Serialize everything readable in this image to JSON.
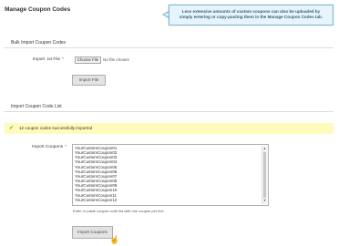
{
  "page": {
    "title": "Manage Coupon Codes"
  },
  "tooltip": {
    "line1": "Less extensive amounts of custom coupons can also be uploaded by",
    "line2": "simply entering or copy-pasting them in the Manage Coupon Codes tab."
  },
  "bulk_import": {
    "section_title": "Bulk Import Coupon Codes",
    "file_label": "Import .txt File",
    "required_mark": "*",
    "choose_file_label": "Choose File",
    "file_status": "No file chosen",
    "import_button": "Import File"
  },
  "code_list": {
    "section_title": "Import Coupon Code List",
    "success_message": "12 coupon codes successfully imported",
    "coupons_label": "Import Coupons",
    "required_mark": "*",
    "coupons": [
      "YourCustomCoupon01",
      "YourCustomCoupon02",
      "YourCustomCoupon03",
      "YourCustomCoupon04",
      "YourCustomCoupon05",
      "YourCustomCoupon06",
      "YourCustomCoupon07",
      "YourCustomCoupon08",
      "YourCustomCoupon09",
      "YourCustomCoupon10",
      "YourCustomCoupon11",
      "YourCustomCoupon12"
    ],
    "hint": "Enter or paste coupon code list with one coupon per line.",
    "import_button": "Import Coupons"
  },
  "colors": {
    "tooltip_bg": "#e8f4fb",
    "tooltip_border": "#79b8d6",
    "success_bg": "#fffbbb",
    "success_icon": "#79a22e",
    "required": "#e22626"
  },
  "icons": {
    "success": "check-icon",
    "scroll_up": "arrow-up-icon",
    "scroll_down": "arrow-down-icon",
    "cursor": "hand-pointer-icon"
  }
}
